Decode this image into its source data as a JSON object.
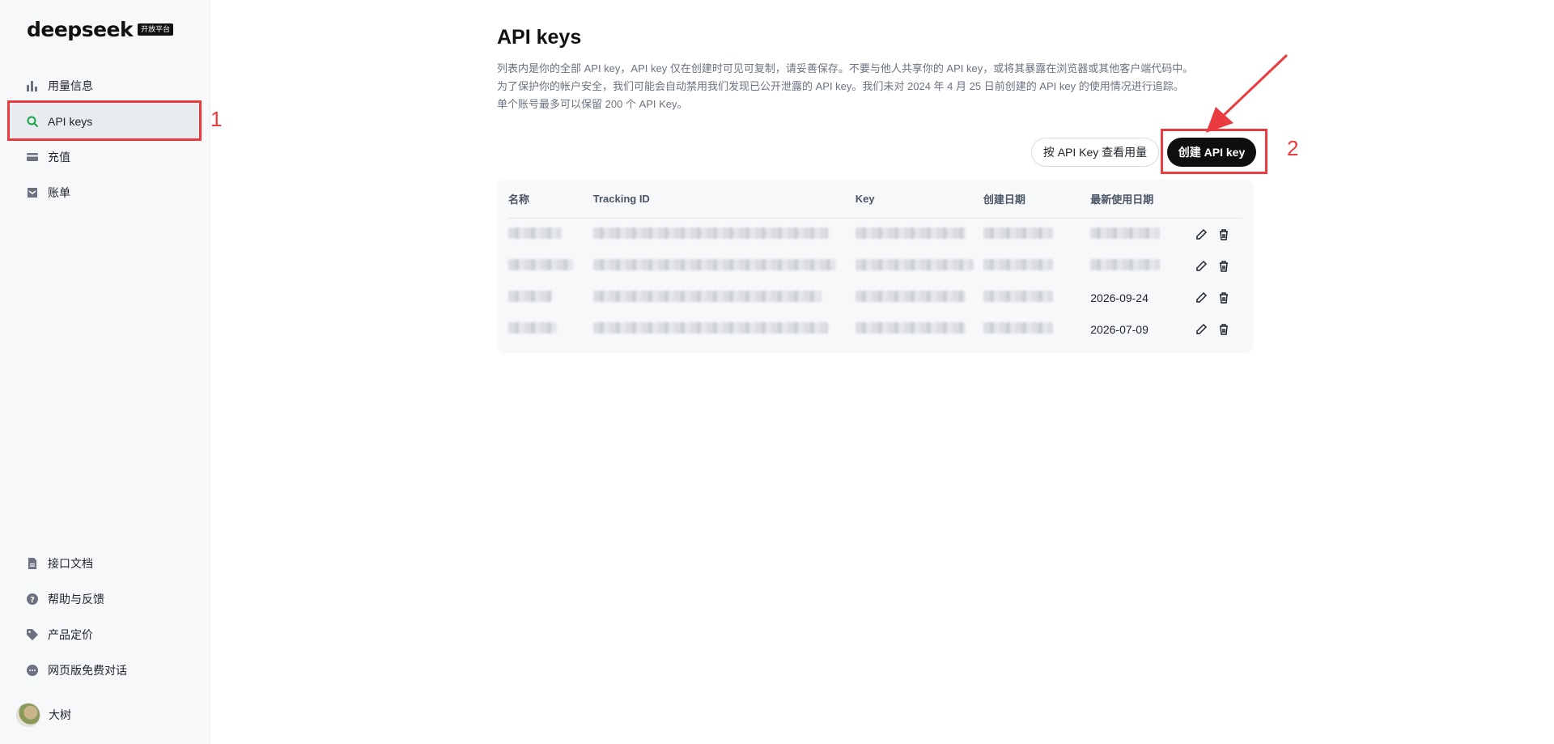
{
  "brand": {
    "name": "deepseek",
    "badge": "开放平台"
  },
  "sidebar": {
    "top_items": [
      {
        "label": "用量信息",
        "icon": "bar-chart-icon",
        "active": false
      },
      {
        "label": "API keys",
        "icon": "search-icon",
        "active": true
      },
      {
        "label": "充值",
        "icon": "wallet-card-icon",
        "active": false
      },
      {
        "label": "账单",
        "icon": "receipt-icon",
        "active": false
      }
    ],
    "bottom_items": [
      {
        "label": "接口文档",
        "icon": "document-icon"
      },
      {
        "label": "帮助与反馈",
        "icon": "help-circle-icon"
      },
      {
        "label": "产品定价",
        "icon": "price-tag-icon"
      },
      {
        "label": "网页版免费对话",
        "icon": "chat-bubble-icon"
      }
    ],
    "user": {
      "name": "大树",
      "icon": "avatar"
    }
  },
  "main": {
    "title": "API keys",
    "description": [
      "列表内是你的全部 API key，API key 仅在创建时可见可复制，请妥善保存。不要与他人共享你的 API key，或将其暴露在浏览器或其他客户端代码中。",
      "为了保护你的帐户安全，我们可能会自动禁用我们发现已公开泄露的 API key。我们未对 2024 年 4 月 25 日前创建的 API key 的使用情况进行追踪。",
      "单个账号最多可以保留 200 个 API Key。"
    ],
    "buttons": {
      "view_usage": "按 API Key 查看用量",
      "create": "创建 API key"
    },
    "table": {
      "headers": [
        "名称",
        "Tracking ID",
        "Key",
        "创建日期",
        "最新使用日期"
      ],
      "rows": [
        {
          "last_used": ""
        },
        {
          "last_used": ""
        },
        {
          "last_used": "2026-09-24"
        },
        {
          "last_used": "2026-07-09"
        }
      ],
      "row_icons": [
        "pencil-icon",
        "trash-icon"
      ]
    }
  },
  "annotations": {
    "marker_1": "1",
    "marker_2": "2",
    "color": "#ea3b3f"
  }
}
